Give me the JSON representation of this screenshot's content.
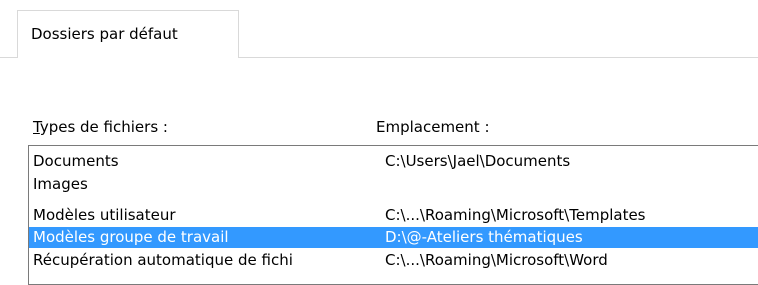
{
  "tabs": [
    {
      "label": "Dossiers par défaut",
      "active": true
    }
  ],
  "columns": {
    "types_accesskey": "T",
    "types_rest": "ypes de fichiers :",
    "location": "Emplacement :"
  },
  "rows": [
    {
      "name": "Documents",
      "path": "C:\\Users\\Jael\\Documents",
      "selected": false
    },
    {
      "name": "Images",
      "path": "",
      "selected": false
    },
    {
      "name": "Modèles utilisateur",
      "path": "C:\\...\\Roaming\\Microsoft\\Templates",
      "selected": false
    },
    {
      "name": "Modèles groupe de travail",
      "path": "D:\\@-Ateliers thématiques",
      "selected": true
    },
    {
      "name": "Récupération automatique de fichi",
      "path": "C:\\...\\Roaming\\Microsoft\\Word",
      "selected": false
    }
  ],
  "colors": {
    "selection_bg": "#3399ff",
    "selection_text": "#ffffff",
    "border": "#7a7a7a",
    "tab_border": "#d9d9d9"
  }
}
